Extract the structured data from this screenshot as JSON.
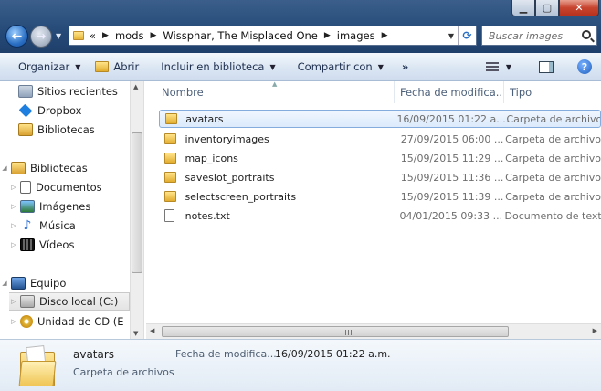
{
  "window": {
    "min_icon": "minimize-icon",
    "max_icon": "maximize-icon",
    "close_icon": "close-icon"
  },
  "address": {
    "overflow": "«",
    "crumbs": [
      "mods",
      "Wissphar, The Misplaced One",
      "images"
    ]
  },
  "search": {
    "placeholder": "Buscar images"
  },
  "toolbar": {
    "organize": "Organizar",
    "open": "Abrir",
    "include": "Incluir en biblioteca",
    "share": "Compartir con",
    "more": "»"
  },
  "nav": {
    "recent": "Sitios recientes",
    "dropbox": "Dropbox",
    "libraries_fav": "Bibliotecas",
    "libraries": "Bibliotecas",
    "documents": "Documentos",
    "images": "Imágenes",
    "music": "Música",
    "videos": "Vídeos",
    "computer": "Equipo",
    "local_disk": "Disco local (C:)",
    "cd_drive": "Unidad de CD (E"
  },
  "columns": {
    "name": "Nombre",
    "date": "Fecha de modifica...",
    "type": "Tipo"
  },
  "files": [
    {
      "name": "avatars",
      "date": "16/09/2015 01:22 a....",
      "type": "Carpeta de archivos"
    },
    {
      "name": "inventoryimages",
      "date": "27/09/2015 06:00 ...",
      "type": "Carpeta de archivos"
    },
    {
      "name": "map_icons",
      "date": "15/09/2015 11:29 ...",
      "type": "Carpeta de archivos"
    },
    {
      "name": "saveslot_portraits",
      "date": "15/09/2015 11:36 ...",
      "type": "Carpeta de archivos"
    },
    {
      "name": "selectscreen_portraits",
      "date": "15/09/2015 11:39 ...",
      "type": "Carpeta de archivos"
    },
    {
      "name": "notes.txt",
      "date": "04/01/2015 09:33 ...",
      "type": "Documento de texto"
    }
  ],
  "details": {
    "name": "avatars",
    "type": "Carpeta de archivos",
    "date_label": "Fecha de modifica...",
    "date_value": "16/09/2015 01:22 a.m."
  },
  "colors": {
    "selection_border": "#84acdd",
    "title_bg": "#254a78",
    "toolbar_text": "#1e2f4e"
  }
}
